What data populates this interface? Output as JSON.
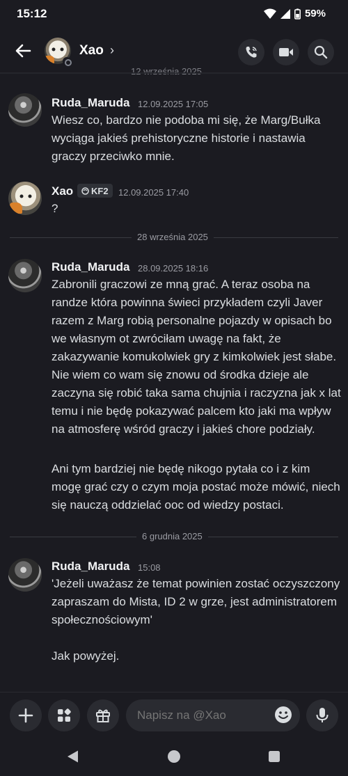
{
  "status": {
    "time": "15:12",
    "battery": "59%"
  },
  "header": {
    "name": "Xao",
    "chevron": "›"
  },
  "top_date": "12 września 2025",
  "dividers": {
    "d2": "28 września 2025",
    "d3": "6 grudnia 2025"
  },
  "messages": [
    {
      "author": "Ruda_Maruda",
      "time": "12.09.2025 17:05",
      "text": "Wiesz co, bardzo nie podoba mi się, że Marg/Bułka wyciąga jakieś prehistoryczne historie i nastawia graczy przeciwko mnie."
    },
    {
      "author": "Xao",
      "tag": "KF2",
      "time": "12.09.2025 17:40",
      "text": "?"
    },
    {
      "author": "Ruda_Maruda",
      "time": "28.09.2025 18:16",
      "text": "Zabronili graczowi ze mną grać. A teraz osoba na randze która powinna świeci przykładem czyli Javer razem z Marg robią personalne pojazdy w opisach bo we własnym ot zwróciłam uwagę na fakt, że zakazywanie komukolwiek gry z kimkolwiek jest słabe. Nie wiem co wam się znowu od środka dzieje ale zaczyna się robić taka sama chujnia i raczyzna jak x lat temu i nie będę pokazywać palcem kto jaki ma wpływ na atmosferę wśród graczy i jakieś chore podziały.",
      "text2": "Ani tym bardziej nie będę nikogo pytała co i z kim mogę grać czy o czym moja postać może mówić, niech się nauczą oddzielać ooc od wiedzy postaci."
    },
    {
      "author": "Ruda_Maruda",
      "time": "15:08",
      "text": "'Jeżeli uważasz że temat powinien zostać oczyszczony zapraszam do Mista, ID 2 w grze, jest administratorem społecznościowym'",
      "text2": "Jak powyżej."
    }
  ],
  "composer": {
    "placeholder": "Napisz na @Xao"
  }
}
